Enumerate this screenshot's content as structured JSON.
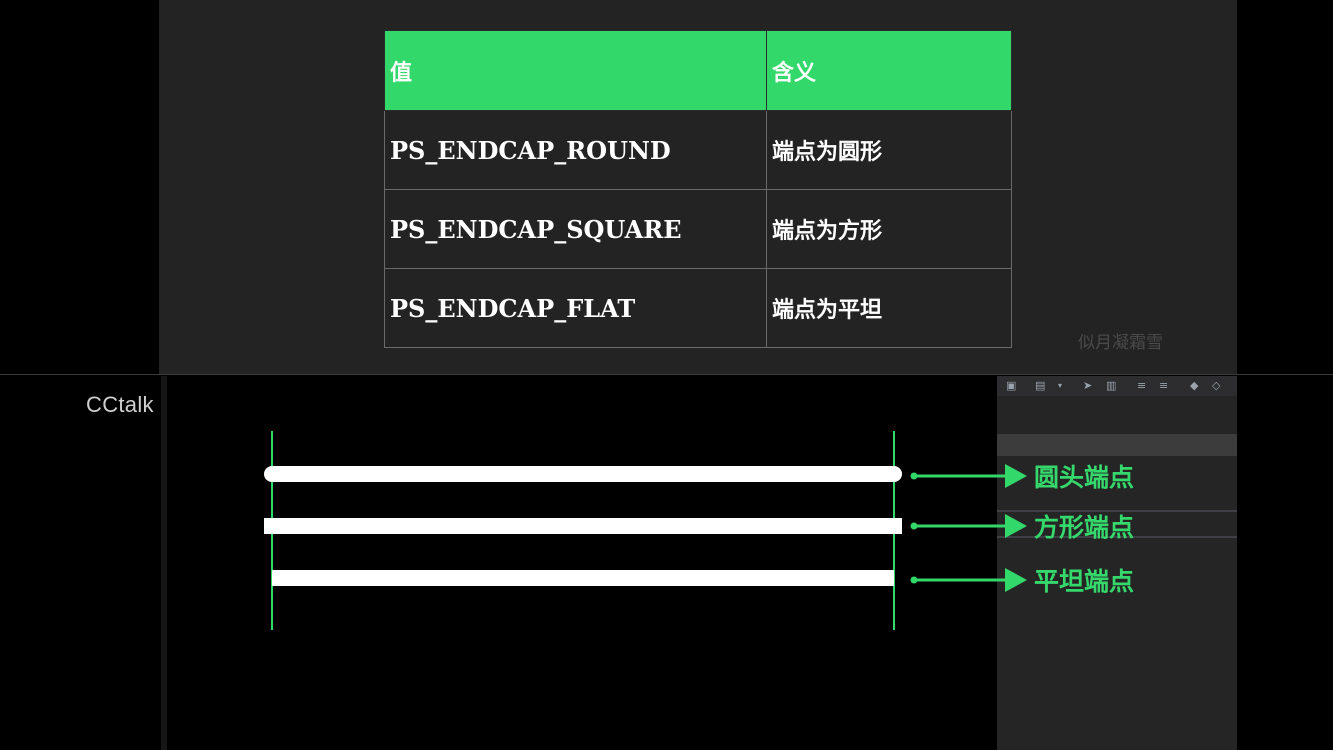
{
  "table": {
    "headers": [
      "值",
      "含义"
    ],
    "rows": [
      {
        "value": "PS_ENDCAP_ROUND",
        "meaning": "端点为圆形"
      },
      {
        "value": "PS_ENDCAP_SQUARE",
        "meaning": "端点为方形"
      },
      {
        "value": "PS_ENDCAP_FLAT",
        "meaning": "端点为平坦"
      }
    ]
  },
  "watermark": "似月凝霜雪",
  "app_label": "CCtalk",
  "diagram": {
    "labels": [
      "圆头端点",
      "方形端点",
      "平坦端点"
    ]
  },
  "ide": {
    "toolbar_icons": [
      "folder-icon",
      "window-icon",
      "dropdown-icon",
      "cursor-icon",
      "copy-icon",
      "indent-icon",
      "outdent-icon",
      "bookmark-icon",
      "bookmark-outline-icon"
    ]
  },
  "colors": {
    "accent_green": "#33d86a",
    "panel_bg": "#232323",
    "background": "#000000",
    "line_white": "#ffffff"
  }
}
